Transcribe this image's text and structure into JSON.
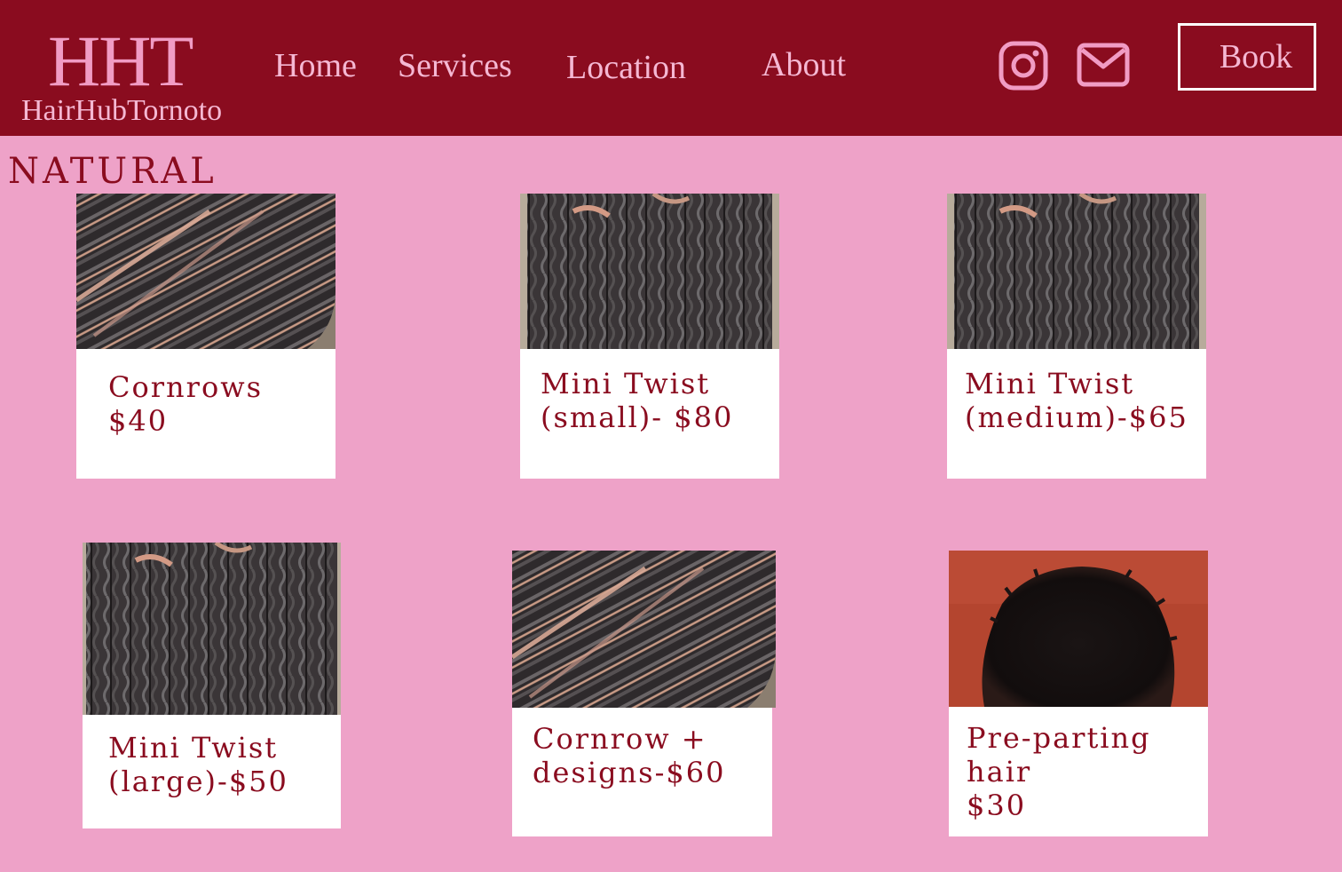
{
  "header": {
    "logo_mark": "HHT",
    "logo_sub": "HairHubTornoto",
    "nav": [
      {
        "label": "Home"
      },
      {
        "label": "Services"
      },
      {
        "label": "Location"
      },
      {
        "label": "About"
      }
    ],
    "icons": [
      "instagram-icon",
      "mail-icon"
    ],
    "book_label": "Book"
  },
  "section": {
    "title": "NATURAL"
  },
  "services": [
    {
      "label": "Cornrows\n$40",
      "image": "cornrows-photo"
    },
    {
      "label": "Mini Twist\n(small)- $80",
      "image": "twists-photo"
    },
    {
      "label": "Mini Twist\n(medium)-$65",
      "image": "twists-photo"
    },
    {
      "label": "Mini Twist\n(large)-$50",
      "image": "twists-photo"
    },
    {
      "label": "Cornrow +\ndesigns-$60",
      "image": "cornrows-photo"
    },
    {
      "label": "Pre-parting\nhair\n$30",
      "image": "afro-photo"
    }
  ],
  "colors": {
    "brand": "#8a0c1f",
    "background": "#eea2c8",
    "nav_text": "#f5b8d3",
    "card": "#ffffff"
  }
}
